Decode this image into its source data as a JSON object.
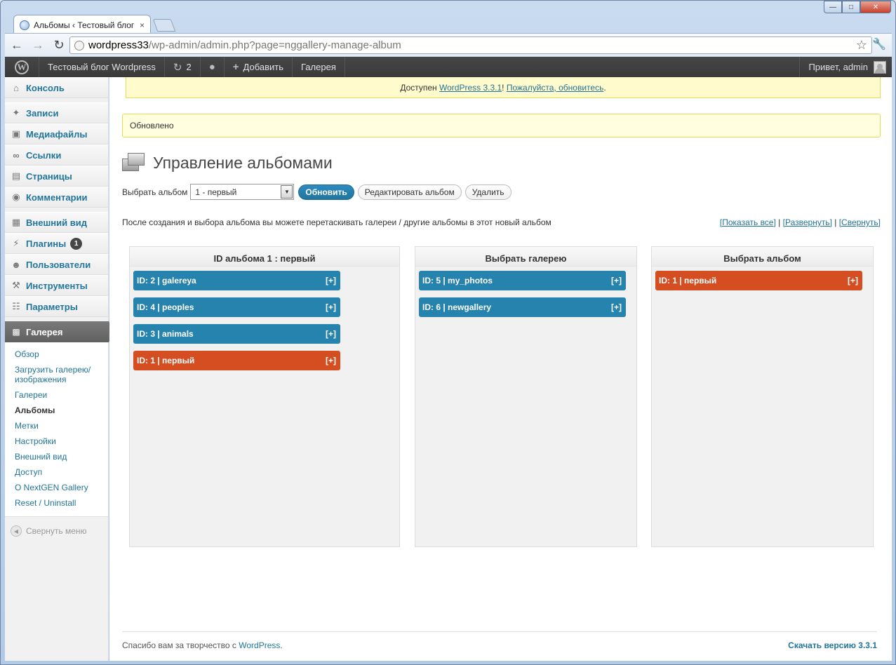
{
  "browser": {
    "tab_title": "Альбомы ‹ Тестовый блог",
    "tab_close": "×",
    "url_host": "wordpress33",
    "url_path": "/wp-admin/admin.php?page=nggallery-manage-album"
  },
  "adminbar": {
    "logo": "W",
    "site_name": "Тестовый блог Wordpress",
    "updates_count": "2",
    "add_new": "Добавить",
    "gallery": "Галерея",
    "greeting": "Привет, admin"
  },
  "sidebar": {
    "items": [
      {
        "label": "Консоль",
        "icon": "home-icon"
      },
      {
        "label": "Записи",
        "icon": "pin-icon"
      },
      {
        "label": "Медиафайлы",
        "icon": "media-icon"
      },
      {
        "label": "Ссылки",
        "icon": "link-icon"
      },
      {
        "label": "Страницы",
        "icon": "pages-icon"
      },
      {
        "label": "Комментарии",
        "icon": "comments-icon"
      },
      {
        "label": "Внешний вид",
        "icon": "appearance-icon"
      },
      {
        "label": "Плагины",
        "icon": "plugins-icon",
        "badge": "1"
      },
      {
        "label": "Пользователи",
        "icon": "users-icon"
      },
      {
        "label": "Инструменты",
        "icon": "tools-icon"
      },
      {
        "label": "Параметры",
        "icon": "settings-icon"
      }
    ],
    "current": {
      "label": "Галерея",
      "icon": "gallery-icon"
    },
    "submenu": [
      "Обзор",
      "Загрузить галерею/ изображения",
      "Галереи",
      "Альбомы",
      "Метки",
      "Настройки",
      "Внешний вид",
      "Доступ",
      "О NextGEN Gallery",
      "Reset / Uninstall"
    ],
    "submenu_current_index": 3,
    "collapse": "Свернуть меню"
  },
  "notices": {
    "update_prefix": "Доступен ",
    "update_link": "WordPress 3.3.1",
    "update_mid": "! ",
    "update_link2": "Пожалуйста, обновитесь",
    "update_suffix": ".",
    "updated": "Обновлено"
  },
  "page": {
    "title": "Управление альбомами",
    "select_label": "Выбрать альбом",
    "select_value": "1 - первый",
    "update_button": "Обновить",
    "edit_button": "Редактировать альбом",
    "delete_button": "Удалить",
    "info": "После создания и выбора альбома вы можете перетаскивать галереи / другие альбомы в этот новый альбом",
    "show_all": "[Показать все]",
    "expand": "[Развернуть]",
    "collapse": "[Свернуть]",
    "separator": " | "
  },
  "panels": [
    {
      "title": "ID альбома 1 : первый",
      "items": [
        {
          "label": "ID: 2 | galereya",
          "plus": "[+]",
          "color": "#2683ae"
        },
        {
          "label": "ID: 4 | peoples",
          "plus": "[+]",
          "color": "#2683ae"
        },
        {
          "label": "ID: 3 | animals",
          "plus": "[+]",
          "color": "#2683ae"
        },
        {
          "label": "ID: 1 | первый",
          "plus": "[+]",
          "color": "#d54e21"
        }
      ]
    },
    {
      "title": "Выбрать галерею",
      "items": [
        {
          "label": "ID: 5 | my_photos",
          "plus": "[+]",
          "color": "#2683ae"
        },
        {
          "label": "ID: 6 | newgallery",
          "plus": "[+]",
          "color": "#2683ae"
        }
      ]
    },
    {
      "title": "Выбрать альбом",
      "items": [
        {
          "label": "ID: 1 | первый",
          "plus": "[+]",
          "color": "#d54e21"
        }
      ]
    }
  ],
  "footer": {
    "thanks_prefix": "Спасибо вам за творчество с ",
    "thanks_link": "WordPress",
    "thanks_suffix": ".",
    "download": "Скачать версию 3.3.1"
  },
  "colors": {
    "link": "#21759b",
    "gallery_item": "#2683ae",
    "album_item": "#d54e21",
    "notice_bg": "#fffbcc"
  }
}
